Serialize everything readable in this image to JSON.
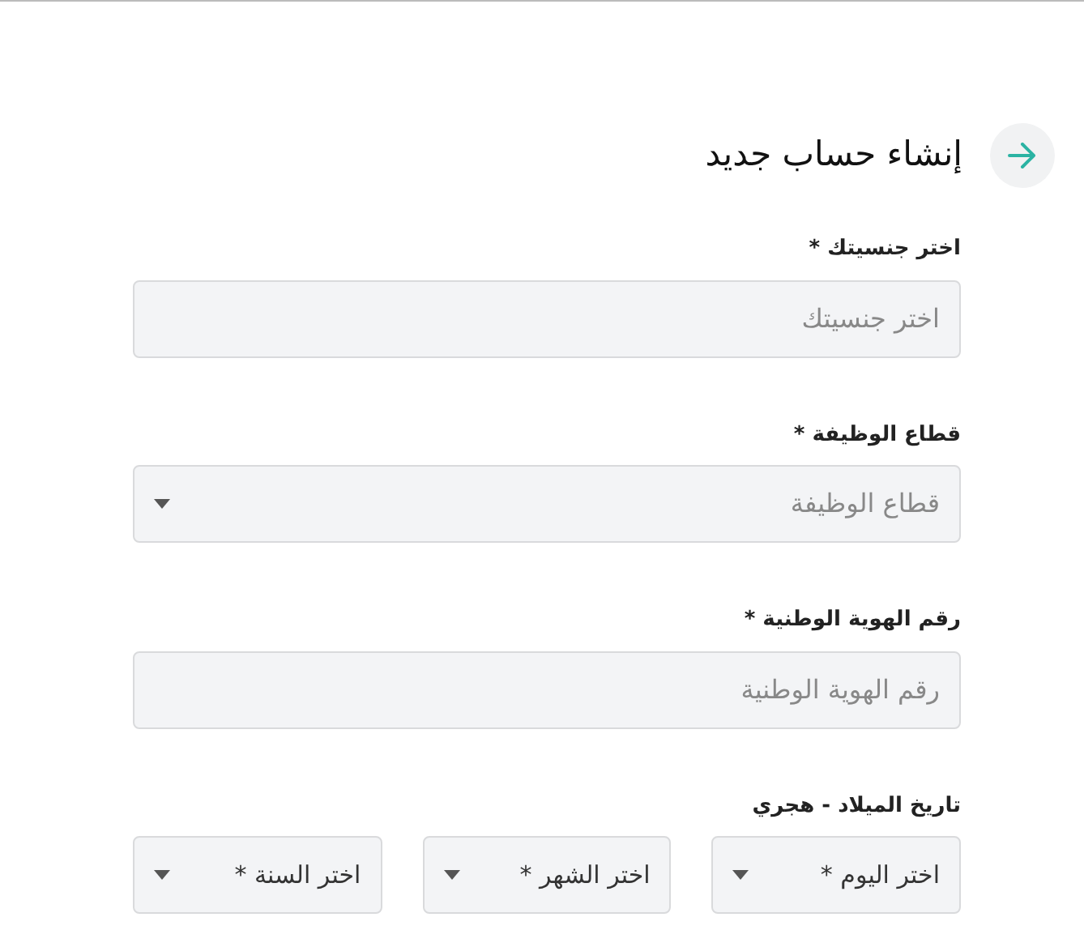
{
  "header": {
    "title": "إنشاء حساب جديد"
  },
  "fields": [
    {
      "kind": "text",
      "label": "اختر جنسيتك *",
      "placeholder": "اختر جنسيتك"
    },
    {
      "kind": "select",
      "label": "قطاع الوظيفة *",
      "placeholder": "قطاع الوظيفة"
    },
    {
      "kind": "text",
      "label": "رقم الهوية الوطنية *",
      "placeholder": "رقم الهوية الوطنية"
    }
  ],
  "birth_date": {
    "label": "تاريخ الميلاد - هجري",
    "selects": [
      {
        "placeholder": "اختر اليوم *"
      },
      {
        "placeholder": "اختر الشهر *"
      },
      {
        "placeholder": "اختر السنة *"
      }
    ]
  }
}
